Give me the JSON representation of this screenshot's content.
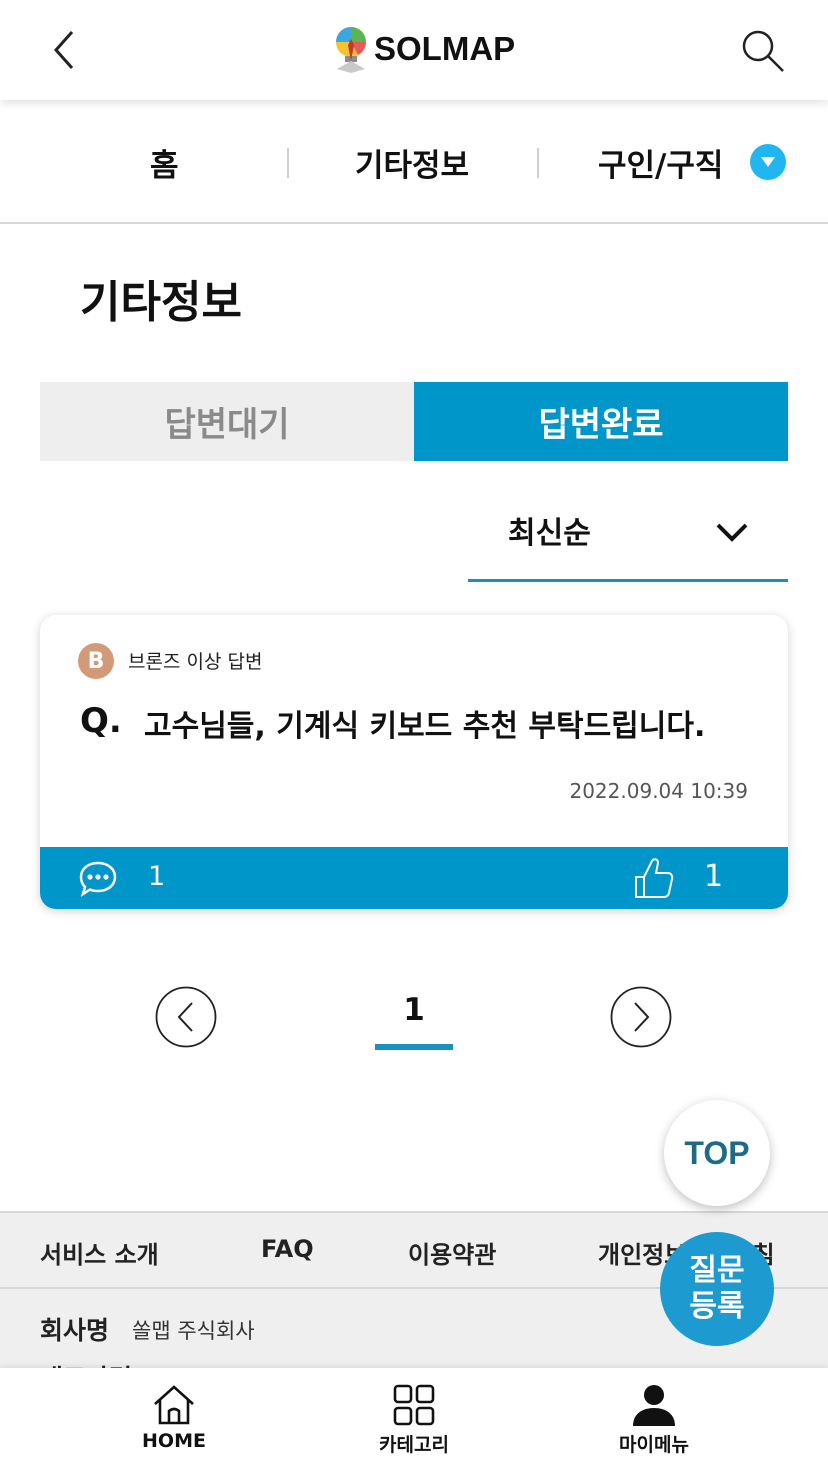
{
  "header": {
    "logo_text": "SOLMAP",
    "back_icon": "chevron-left-icon",
    "search_icon": "search-icon"
  },
  "breadcrumb": {
    "items": [
      "홈",
      "기타정보",
      "구인/구직"
    ],
    "toggle_icon": "triangle-down-icon",
    "toggle_color": "#21b6f0"
  },
  "page_title": "기타정보",
  "tabs": {
    "waiting": "답변대기",
    "done": "답변완료",
    "active": "done",
    "active_color": "#0196c9"
  },
  "sort": {
    "selected": "최신순",
    "icon": "chevron-down-icon"
  },
  "posts": [
    {
      "badge_letter": "B",
      "badge_label": "브론즈 이상 답변",
      "badge_color": "#d39a78",
      "q_mark": "Q.",
      "title": "고수님들, 기계식 키보드 추천 부탁드립니다.",
      "date": "2022.09.04 10:39",
      "comments": "1",
      "likes": "1"
    }
  ],
  "pagination": {
    "current": "1"
  },
  "floating": {
    "top_label": "TOP",
    "ask_line1": "질문",
    "ask_line2": "등록"
  },
  "footer": {
    "links": [
      "서비스 소개",
      "FAQ",
      "이용약관",
      "개인정보처리방침"
    ],
    "company_key": "회사명",
    "company_value": "쏠맵 주식회사",
    "cut_text": "대표자명"
  },
  "bottom_nav": [
    {
      "label": "HOME",
      "icon": "home-icon"
    },
    {
      "label": "카테고리",
      "icon": "grid-icon"
    },
    {
      "label": "마이메뉴",
      "icon": "person-icon"
    }
  ]
}
